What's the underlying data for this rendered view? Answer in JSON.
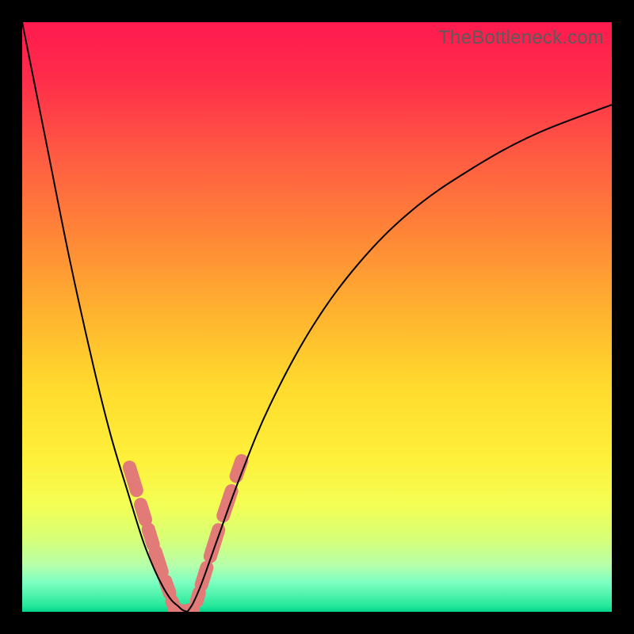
{
  "watermark": "TheBottleneck.com",
  "chart_data": {
    "type": "line",
    "title": "",
    "xlabel": "",
    "ylabel": "",
    "xlim": [
      0,
      100
    ],
    "ylim": [
      0,
      100
    ],
    "grid": false,
    "series": [
      {
        "name": "left-curve",
        "x": [
          0,
          4,
          8,
          12,
          15,
          18,
          20.5,
          22.5,
          24,
          25.3,
          26.4,
          27.2,
          28
        ],
        "y": [
          100,
          80,
          60,
          42,
          30,
          20,
          12,
          7,
          4,
          2,
          1,
          0.3,
          0
        ]
      },
      {
        "name": "right-curve",
        "x": [
          28,
          29,
          30.5,
          33,
          37,
          42,
          49,
          57,
          66,
          76,
          87,
          100
        ],
        "y": [
          0,
          1.5,
          5,
          12,
          23,
          35,
          48,
          59,
          68,
          75,
          81,
          86
        ]
      }
    ],
    "highlight_segments": {
      "left": [
        {
          "p0": [
            18.2,
            24.5
          ],
          "p1": [
            19.4,
            20.6
          ]
        },
        {
          "p0": [
            20.1,
            18.2
          ],
          "p1": [
            20.9,
            15.6
          ]
        },
        {
          "p0": [
            21.4,
            14.0
          ],
          "p1": [
            22.2,
            11.4
          ]
        },
        {
          "p0": [
            22.6,
            10.2
          ],
          "p1": [
            23.7,
            6.8
          ]
        },
        {
          "p0": [
            24.3,
            5.2
          ],
          "p1": [
            25.0,
            3.2
          ]
        },
        {
          "p0": [
            25.4,
            1.8
          ],
          "p1": [
            25.8,
            0.8
          ]
        }
      ],
      "bottom": [
        {
          "p0": [
            25.8,
            0.45
          ],
          "p1": [
            27.4,
            0.05
          ]
        },
        {
          "p0": [
            27.4,
            0.05
          ],
          "p1": [
            29.0,
            0.45
          ]
        }
      ],
      "right": [
        {
          "p0": [
            29.6,
            1.8
          ],
          "p1": [
            30.0,
            3.2
          ]
        },
        {
          "p0": [
            30.4,
            4.6
          ],
          "p1": [
            31.3,
            7.5
          ]
        },
        {
          "p0": [
            31.9,
            9.4
          ],
          "p1": [
            33.3,
            13.9
          ]
        },
        {
          "p0": [
            34.1,
            16.3
          ],
          "p1": [
            35.5,
            20.5
          ]
        },
        {
          "p0": [
            36.3,
            23.0
          ],
          "p1": [
            37.2,
            25.6
          ]
        }
      ]
    },
    "background_gradient": {
      "top": "#ff1a4f",
      "mid_upper": "#ff8637",
      "mid": "#ffdb2d",
      "mid_lower": "#d4ff7a",
      "bottom": "#00d48b"
    }
  }
}
